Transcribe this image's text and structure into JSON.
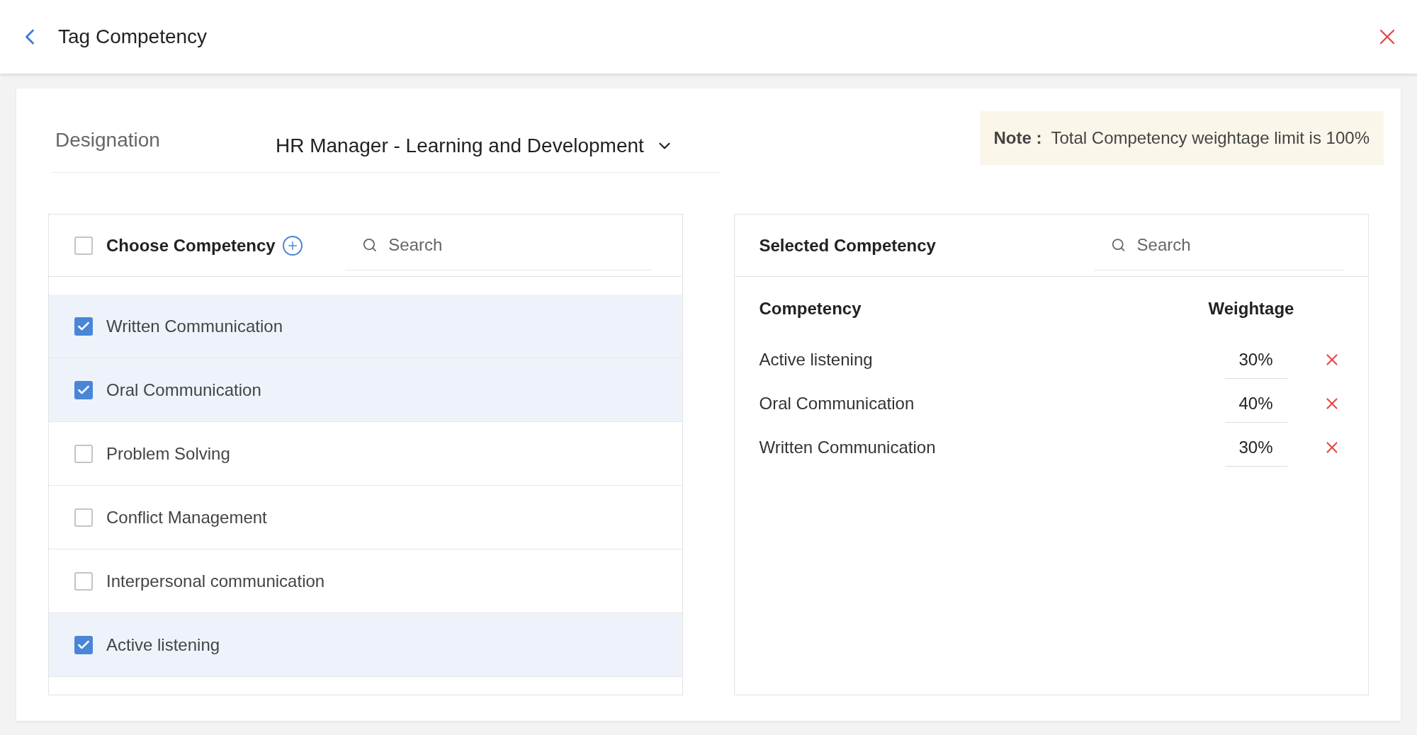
{
  "header": {
    "title": "Tag Competency"
  },
  "designation": {
    "label": "Designation",
    "value": "HR Manager - Learning and Development"
  },
  "note": {
    "label": "Note :",
    "text": "Total Competency weightage limit is 100%"
  },
  "choose": {
    "title": "Choose Competency",
    "all_checked": false,
    "search_placeholder": "Search",
    "items": [
      {
        "label": "Written Communication",
        "checked": true
      },
      {
        "label": "Oral Communication",
        "checked": true
      },
      {
        "label": "Problem Solving",
        "checked": false
      },
      {
        "label": "Conflict Management",
        "checked": false
      },
      {
        "label": "Interpersonal communication",
        "checked": false
      },
      {
        "label": "Active listening",
        "checked": true
      }
    ]
  },
  "selected": {
    "title": "Selected Competency",
    "search_placeholder": "Search",
    "columns": [
      "Competency",
      "Weightage"
    ],
    "rows": [
      {
        "name": "Active listening",
        "weightage": "30%"
      },
      {
        "name": "Oral Communication",
        "weightage": "40%"
      },
      {
        "name": "Written Communication",
        "weightage": "30%"
      }
    ]
  }
}
